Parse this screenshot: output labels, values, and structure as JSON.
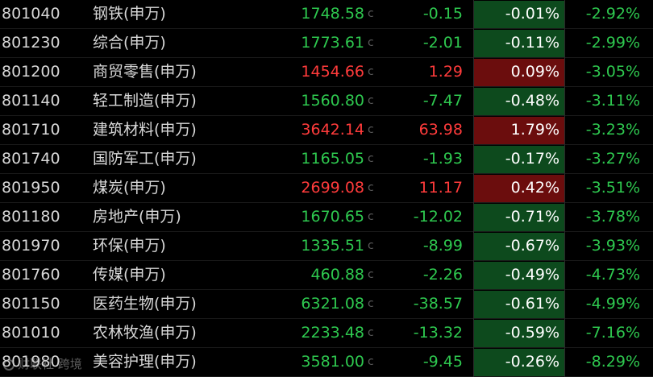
{
  "colors": {
    "up_text": "#ff3b3b",
    "down_text": "#2ec84f",
    "up_bg": "#6b0d0d",
    "down_bg": "#0d4a1d",
    "neutral_text": "#d8d8d8",
    "background": "#000000"
  },
  "rows": [
    {
      "code": "801040",
      "name": "钢铁(申万)",
      "price": "1748.58",
      "flag": "c",
      "change": "-0.15",
      "pct": "-0.01%",
      "pct5": "-2.92%",
      "dir": "down"
    },
    {
      "code": "801230",
      "name": "综合(申万)",
      "price": "1773.61",
      "flag": "c",
      "change": "-2.01",
      "pct": "-0.11%",
      "pct5": "-2.99%",
      "dir": "down"
    },
    {
      "code": "801200",
      "name": "商贸零售(申万)",
      "price": "1454.66",
      "flag": "c",
      "change": "1.29",
      "pct": "0.09%",
      "pct5": "-3.05%",
      "dir": "up"
    },
    {
      "code": "801140",
      "name": "轻工制造(申万)",
      "price": "1560.80",
      "flag": "c",
      "change": "-7.47",
      "pct": "-0.48%",
      "pct5": "-3.11%",
      "dir": "down"
    },
    {
      "code": "801710",
      "name": "建筑材料(申万)",
      "price": "3642.14",
      "flag": "c",
      "change": "63.98",
      "pct": "1.79%",
      "pct5": "-3.23%",
      "dir": "up"
    },
    {
      "code": "801740",
      "name": "国防军工(申万)",
      "price": "1165.05",
      "flag": "c",
      "change": "-1.93",
      "pct": "-0.17%",
      "pct5": "-3.27%",
      "dir": "down"
    },
    {
      "code": "801950",
      "name": "煤炭(申万)",
      "price": "2699.08",
      "flag": "c",
      "change": "11.17",
      "pct": "0.42%",
      "pct5": "-3.51%",
      "dir": "up"
    },
    {
      "code": "801180",
      "name": "房地产(申万)",
      "price": "1670.65",
      "flag": "c",
      "change": "-12.02",
      "pct": "-0.71%",
      "pct5": "-3.78%",
      "dir": "down"
    },
    {
      "code": "801970",
      "name": "环保(申万)",
      "price": "1335.51",
      "flag": "c",
      "change": "-8.99",
      "pct": "-0.67%",
      "pct5": "-3.93%",
      "dir": "down"
    },
    {
      "code": "801760",
      "name": "传媒(申万)",
      "price": "460.88",
      "flag": "c",
      "change": "-2.26",
      "pct": "-0.49%",
      "pct5": "-4.73%",
      "dir": "down"
    },
    {
      "code": "801150",
      "name": "医药生物(申万)",
      "price": "6321.08",
      "flag": "c",
      "change": "-38.57",
      "pct": "-0.61%",
      "pct5": "-4.99%",
      "dir": "down"
    },
    {
      "code": "801010",
      "name": "农林牧渔(申万)",
      "price": "2233.48",
      "flag": "c",
      "change": "-13.32",
      "pct": "-0.59%",
      "pct5": "-7.16%",
      "dir": "down"
    },
    {
      "code": "801980",
      "name": "美容护理(申万)",
      "price": "3581.00",
      "flag": "c",
      "change": "-9.45",
      "pct": "-0.26%",
      "pct5": "-8.29%",
      "dir": "down"
    }
  ],
  "watermark": {
    "text": "财联社 跨境"
  }
}
